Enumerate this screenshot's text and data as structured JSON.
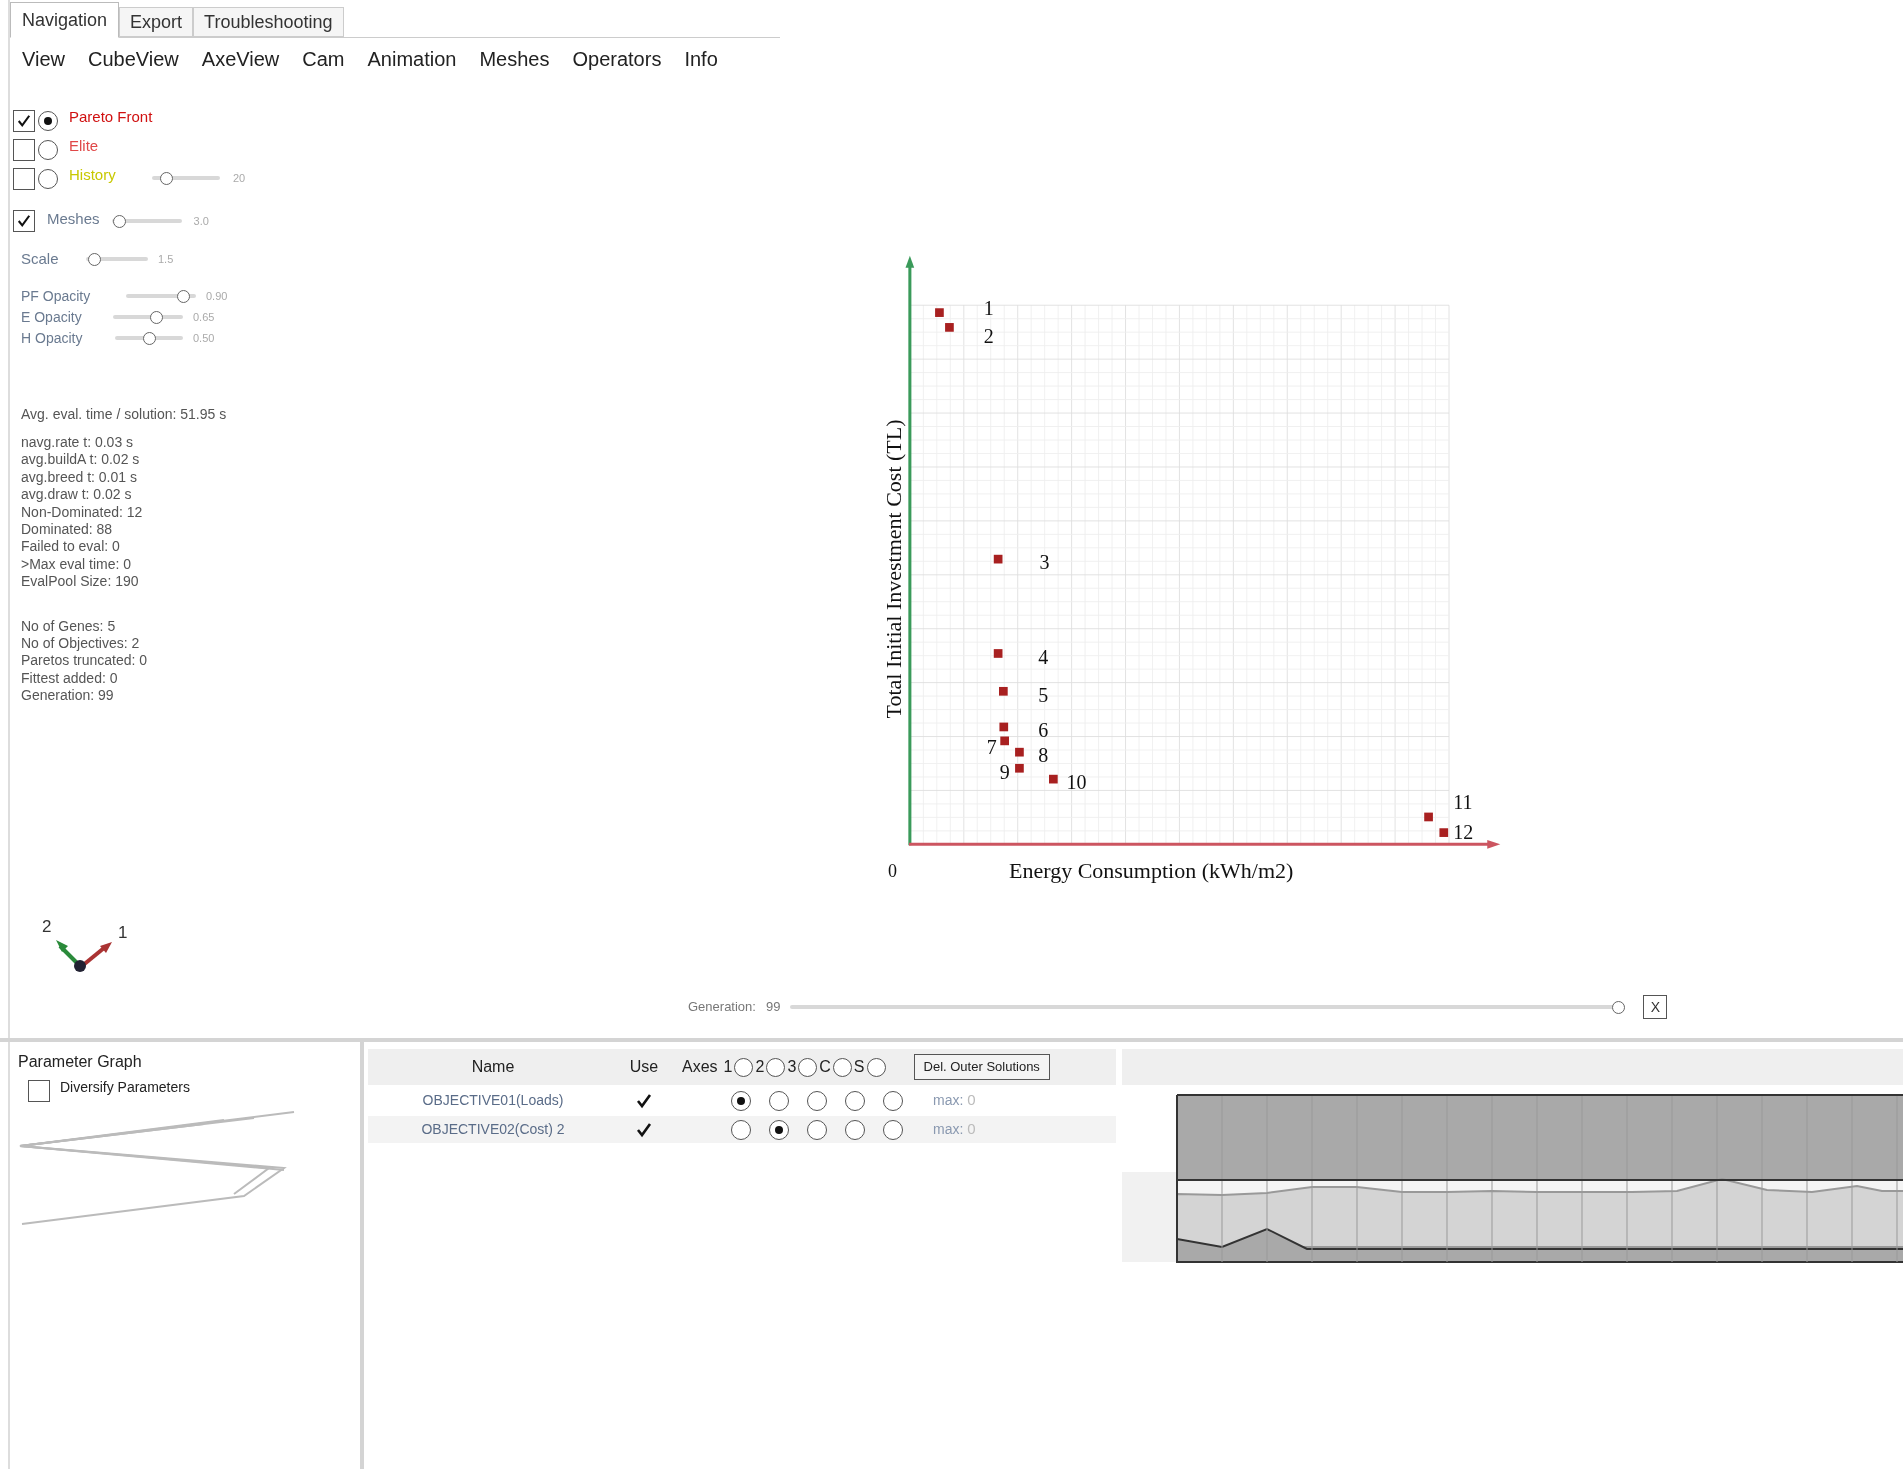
{
  "tabs": [
    {
      "label": "Navigation",
      "selected": true
    },
    {
      "label": "Export",
      "selected": false
    },
    {
      "label": "Troubleshooting",
      "selected": false
    }
  ],
  "menu": [
    "View",
    "CubeView",
    "AxeView",
    "Cam",
    "Animation",
    "Meshes",
    "Operators",
    "Info"
  ],
  "layers": [
    {
      "label": "Pareto Front",
      "checked": true,
      "selected": true,
      "color": "#d01010"
    },
    {
      "label": "Elite",
      "checked": false,
      "selected": false,
      "color": "#e04848"
    },
    {
      "label": "History",
      "checked": false,
      "selected": false,
      "color": "#c8c800",
      "slider": {
        "level": 0.15,
        "reading": "20"
      }
    }
  ],
  "meshes": {
    "label": "Meshes",
    "checked": true,
    "level": 0.03,
    "reading": "3.0"
  },
  "sliders": [
    {
      "label": "Scale",
      "level": 0.05,
      "reading": "1.5"
    },
    {
      "label": "PF Opacity",
      "level": 0.9,
      "reading": "0.90"
    },
    {
      "label": "E Opacity",
      "level": 0.65,
      "reading": "0.65"
    },
    {
      "label": "H Opacity",
      "level": 0.5,
      "reading": "0.50"
    }
  ],
  "eval_time": "Avg. eval. time / solution: 51.95 s",
  "stats": [
    "navg.rate t: 0.03 s",
    "avg.buildA t: 0.02 s",
    "avg.breed t: 0.01 s",
    "avg.draw t: 0.02 s",
    "Non-Dominated: 12",
    "Dominated: 88",
    "Failed to eval: 0",
    ">Max eval time: 0",
    "EvalPool Size: 190"
  ],
  "stats_2": [
    "No of Genes: 5",
    "No of Objectives: 2",
    "Paretos truncated: 0",
    "Fittest added: 0",
    "Generation: 99"
  ],
  "plot": {
    "y_label": "Total Initial Investment Cost (TL)",
    "x_label": "Energy Consumption (kWh/m2)",
    "origin_label": "0",
    "point_labels": [
      "1",
      "2",
      "3",
      "4",
      "5",
      "6",
      "7",
      "8",
      "9",
      "10",
      "11",
      "12"
    ]
  },
  "axis_gizmo": {
    "labels": [
      "2",
      "1"
    ]
  },
  "generation": {
    "label": "Generation:",
    "value": "99",
    "level": 1.0,
    "close": "X"
  },
  "parameter_graph": {
    "title": "Parameter Graph",
    "diversify": {
      "label": "Diversify Parameters",
      "checked": false
    }
  },
  "objectives": {
    "columns": [
      "Name",
      "Use"
    ],
    "axes_label": "Axes",
    "axes_options": [
      {
        "label": "1",
        "selected": false
      },
      {
        "label": "2",
        "selected": false
      },
      {
        "label": "3",
        "selected": false
      },
      {
        "label": "C",
        "selected": false
      },
      {
        "label": "S",
        "selected": false
      }
    ],
    "button": "Del. Outer Solutions",
    "rows": [
      {
        "name": "OBJECTIVE01(Loads)",
        "use": true,
        "axes": [
          {
            "selected": true
          },
          {
            "selected": false
          },
          {
            "selected": false
          },
          {
            "selected": false
          },
          {
            "selected": false
          }
        ],
        "max_label": "max:",
        "max": "0"
      },
      {
        "name": "OBJECTIVE02(Cost) 2",
        "use": true,
        "axes": [
          {
            "selected": false
          },
          {
            "selected": true
          },
          {
            "selected": false
          },
          {
            "selected": false
          },
          {
            "selected": false
          }
        ],
        "max_label": "max:",
        "max": "0"
      }
    ]
  }
}
